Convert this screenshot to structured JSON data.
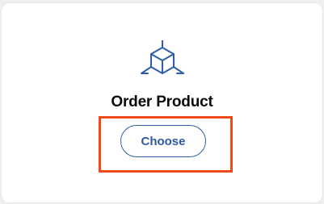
{
  "card": {
    "icon": "cube-box-icon",
    "title": "Order Product",
    "button_label": "Choose"
  },
  "colors": {
    "accent": "#2f5ea8",
    "highlight": "#f04a1a",
    "title": "#0a0a0a"
  }
}
